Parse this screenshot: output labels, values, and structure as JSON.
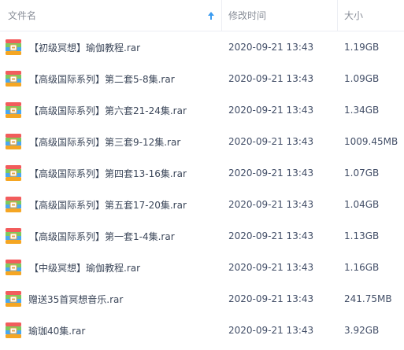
{
  "header": {
    "name_label": "文件名",
    "date_label": "修改时间",
    "size_label": "大小"
  },
  "colors": {
    "header_text": "#8a8f99",
    "sort_arrow": "#3a9bf0",
    "row_text": "#424e67"
  },
  "icons": {
    "sort": "arrow-up-icon",
    "file": "rar-archive-icon"
  },
  "files": [
    {
      "name": "【初级冥想】瑜伽教程.rar",
      "date": "2020-09-21 13:43",
      "size": "1.19GB"
    },
    {
      "name": "【高级国际系列】第二套5-8集.rar",
      "date": "2020-09-21 13:43",
      "size": "1.09GB"
    },
    {
      "name": "【高级国际系列】第六套21-24集.rar",
      "date": "2020-09-21 13:43",
      "size": "1.34GB"
    },
    {
      "name": "【高级国际系列】第三套9-12集.rar",
      "date": "2020-09-21 13:43",
      "size": "1009.45MB"
    },
    {
      "name": "【高级国际系列】第四套13-16集.rar",
      "date": "2020-09-21 13:43",
      "size": "1.07GB"
    },
    {
      "name": "【高级国际系列】第五套17-20集.rar",
      "date": "2020-09-21 13:43",
      "size": "1.04GB"
    },
    {
      "name": "【高级国际系列】第一套1-4集.rar",
      "date": "2020-09-21 13:43",
      "size": "1.13GB"
    },
    {
      "name": "【中级冥想】瑜伽教程.rar",
      "date": "2020-09-21 13:43",
      "size": "1.16GB"
    },
    {
      "name": "赠送35首冥想音乐.rar",
      "date": "2020-09-21 13:43",
      "size": "241.75MB"
    },
    {
      "name": "瑜珈40集.rar",
      "date": "2020-09-21 13:43",
      "size": "3.92GB"
    }
  ]
}
